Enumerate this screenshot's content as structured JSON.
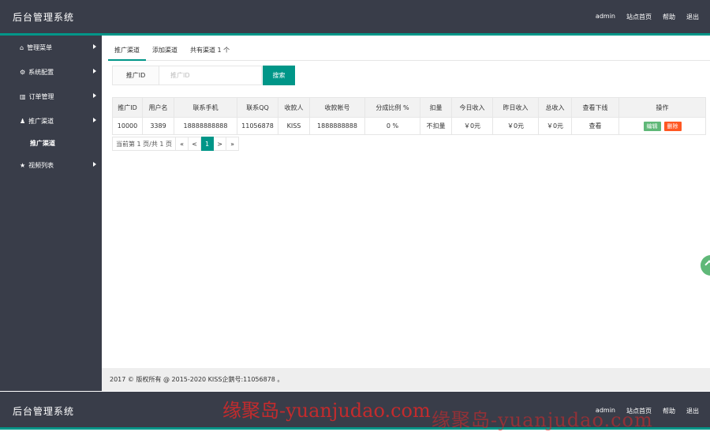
{
  "header": {
    "title": "后台管理系统",
    "nav": [
      "admin",
      "站点首页",
      "帮助",
      "退出"
    ]
  },
  "sidebar": {
    "items": [
      {
        "icon": "home-icon",
        "glyph": "⌂",
        "label": "管理菜单"
      },
      {
        "icon": "gears-icon",
        "glyph": "⚙",
        "label": "系统配置"
      },
      {
        "icon": "chart-icon",
        "glyph": "▥",
        "label": "订单管理"
      },
      {
        "icon": "user-icon",
        "glyph": "♟",
        "label": "推广渠道"
      },
      {
        "icon": "star-icon",
        "glyph": "★",
        "label": "视频列表"
      }
    ],
    "subitem": "推广渠道"
  },
  "tabs": [
    "推广渠道",
    "添加渠道",
    "共有渠道 1 个"
  ],
  "search": {
    "label": "推广ID",
    "placeholder": "推广ID",
    "button": "搜索"
  },
  "table": {
    "headers": [
      "推广ID",
      "用户名",
      "联系手机",
      "联系QQ",
      "收款人",
      "收款帐号",
      "分成比例 %",
      "扣量",
      "今日收入",
      "昨日收入",
      "总收入",
      "查看下线",
      "操作"
    ],
    "rows": [
      {
        "cells": [
          "10000",
          "3389",
          "18888888888",
          "11056878",
          "KISS",
          "1888888888",
          "0 %",
          "不扣量",
          "￥0元",
          "￥0元",
          "￥0元",
          "查看"
        ],
        "edit": "编辑",
        "delete": "删除"
      }
    ]
  },
  "pager": {
    "info": "当前第 1 页/共 1 页",
    "first": "«",
    "prev": "<",
    "current": "1",
    "next": ">",
    "last": "»"
  },
  "footer": "2017 © 版权所有 @ 2015-2020 KISS企鹅号:11056878 。",
  "watermark": "缘聚岛-yuanjudao.com",
  "colors": {
    "topbar": "#393D49",
    "accent": "#009688",
    "edit": "#5FB878",
    "delete": "#FF5722"
  }
}
